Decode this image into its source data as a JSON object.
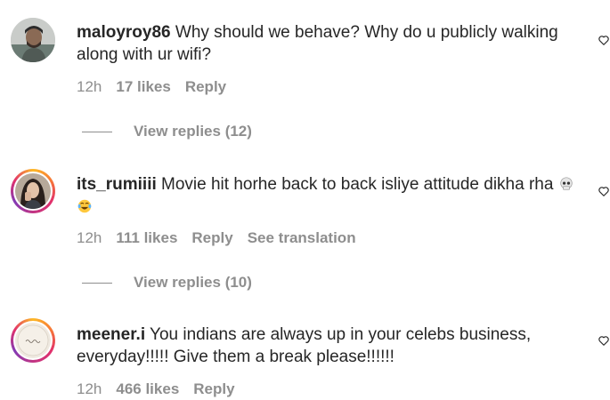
{
  "comments": [
    {
      "username": "maloyroy86",
      "text": " Why should we behave? Why do u publicly walking along with ur wifi?",
      "time": "12h",
      "likes": "17 likes",
      "reply": "Reply",
      "view_replies": "View replies (12)"
    },
    {
      "username": "its_rumiiii",
      "text": " Movie hit horhe back to back isliye attitude dikha rha ",
      "emojis": [
        "skull-emoji",
        "tears-of-joy-emoji"
      ],
      "time": "12h",
      "likes": "111 likes",
      "reply": "Reply",
      "translate": "See translation",
      "view_replies": "View replies (10)"
    },
    {
      "username": "meener.i",
      "text": " You indians are always up in your celebs business, everyday!!!!! Give them a break please!!!!!!",
      "time": "12h",
      "likes": "466 likes",
      "reply": "Reply"
    }
  ],
  "colors": {
    "primary_text": "#262626",
    "secondary_text": "#8e8e8e",
    "story_ring": "#e1306c"
  },
  "icons": {
    "like": "heart-outline-icon"
  }
}
